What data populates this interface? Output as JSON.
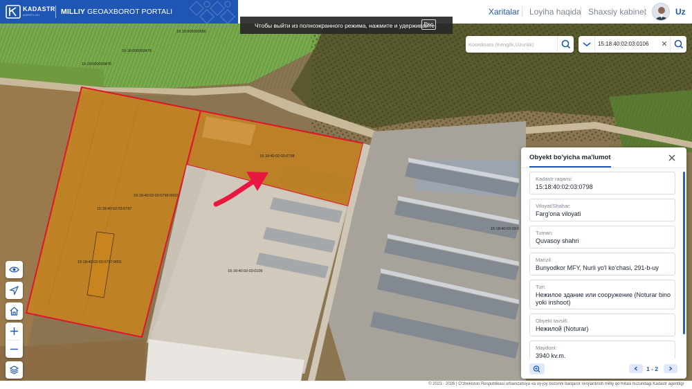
{
  "header": {
    "brand_name": "KADASTR",
    "brand_sub": "AGENTLIGI",
    "portal_title_bold": "MILLIY",
    "portal_title_rest": " GEOAXBOROT PORTALI",
    "nav": [
      {
        "label": "Xaritalar",
        "active": true
      },
      {
        "label": "Loyiha haqida",
        "active": false
      },
      {
        "label": "Shaxsiy kabinet",
        "active": false
      }
    ],
    "language": "Uz"
  },
  "fullscreen_toast": {
    "text": "Чтобы выйти из полноэкранного режима, нажмите и удерживайте",
    "key": "Esc"
  },
  "search": {
    "coordinate_placeholder": "Koordinata (Kenglik,Uzunlik)",
    "cadastre_value": "15:18:40:02:03:0106"
  },
  "map": {
    "parcel_labels": [
      "15:18:000000956",
      "15:18:000003475",
      "15:18:000003476",
      "15:18:40:02:03:0798",
      "15:18:40:02:03:0798:0002",
      "15:18:40:02:03:0797",
      "15:18:40:02:03:0797:0001",
      "15:18:40:02:03:0106",
      "15:18:40:02:03:0"
    ]
  },
  "tools": [
    "eye-icon",
    "navigation-icon",
    "home-icon",
    "zoom-in-icon",
    "zoom-out-icon",
    "layers-icon"
  ],
  "panel": {
    "title": "Obyekt bo'yicha ma'lumot",
    "fields": [
      {
        "label": "Kadastr raqami:",
        "value": "15:18:40:02:03:0798"
      },
      {
        "label": "Viloyat/Shahar:",
        "value": "Farg'ona viloyati"
      },
      {
        "label": "Tuman:",
        "value": "Quvasoy shahri"
      },
      {
        "label": "Manzil:",
        "value": "Bunyodkor MFY, Nurli yo'l ko'chasi, 291-b-uy"
      },
      {
        "label": "Turi:",
        "value": "Нежилое здание или сооружение (Noturar bino yoki inshoot)"
      },
      {
        "label": "Obyekt tavsifi:",
        "value": "Нежилой (Noturar)"
      },
      {
        "label": "Maydoni:",
        "value": "3940 kv.m."
      }
    ],
    "pager": "1 - 2"
  },
  "footer": {
    "text": "© 2023 - 2026 | O'zbekiston Respublikasi urbanizatsiya va uy-joy bozorini barqaror rivojlantirish milliy qo'mitasi huzuridagi Kadastr agentligi"
  },
  "colors": {
    "brand_blue": "#1f56b3",
    "parcel_fill": "#c8841e",
    "parcel_outline": "#e0142a",
    "arrow": "#e8173f"
  }
}
